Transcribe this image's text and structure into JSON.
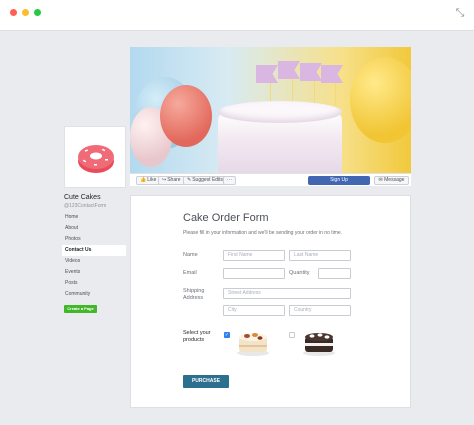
{
  "window": {
    "icons": [
      "close-dot",
      "minimize-dot",
      "maximize-dot",
      "expand-icon"
    ]
  },
  "cover": {
    "colors": {
      "balloon_blue": "#9cc9e2",
      "balloon_red": "#e2685c",
      "balloon_yellow": "#f1c533",
      "flag": "#d9b7e2"
    }
  },
  "actions": {
    "like": "Like",
    "share": "Share",
    "suggest_edits": "Suggest Edits",
    "more": "···",
    "sign_up": "Sign Up",
    "message": "Message"
  },
  "page": {
    "name": "Cute Cakes",
    "handle": "@123ContactForm",
    "nav": [
      "Home",
      "About",
      "Photos",
      "Contact Us",
      "Videos",
      "Events",
      "Posts",
      "Community"
    ],
    "active_nav": "Contact Us",
    "create_page": "Create a Page"
  },
  "form": {
    "title": "Cake Order Form",
    "description": "Please fill in your information and we'll be sending your order in no time.",
    "name_label": "Name",
    "first_name_placeholder": "First Name",
    "last_name_placeholder": "Last Name",
    "email_label": "Email",
    "quantity_label": "Quantity",
    "shipping_label": "Shipping Address",
    "street_placeholder": "Street Address",
    "city_placeholder": "City",
    "country_placeholder": "Country",
    "products_label": "Select your products",
    "product1_checked": true,
    "product2_checked": false,
    "purchase_label": "PURCHASE",
    "colors": {
      "accent": "#2d6f8f",
      "checkbox": "#2f80ed",
      "signup": "#4267b2",
      "create": "#42b72a"
    }
  }
}
